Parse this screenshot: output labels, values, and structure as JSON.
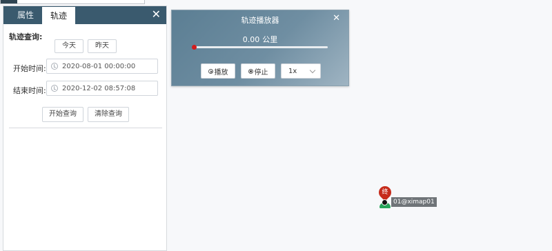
{
  "left_panel": {
    "tabs": [
      {
        "label": "属性",
        "active": false
      },
      {
        "label": "轨迹",
        "active": true
      }
    ],
    "close_icon": "close-icon",
    "section_title": "轨迹查询:",
    "quick_buttons": {
      "today": "今天",
      "yesterday": "昨天"
    },
    "start_label": "开始时间:",
    "start_value": "2020-08-01 00:00:00",
    "end_label": "结束时间:",
    "end_value": "2020-12-02 08:57:08",
    "query_button": "开始查询",
    "clear_button": "清除查询"
  },
  "player": {
    "title": "轨迹播放器",
    "distance_value": "0.00",
    "distance_unit": "公里",
    "progress": 0.0,
    "play_label": "播放",
    "stop_label": "停止",
    "speed_value": "1x",
    "colors": {
      "progress": "#d21d1d",
      "header": "#5b7e93"
    }
  },
  "map": {
    "end_marker_label": "终",
    "vehicle_label": "01@ximap01"
  }
}
